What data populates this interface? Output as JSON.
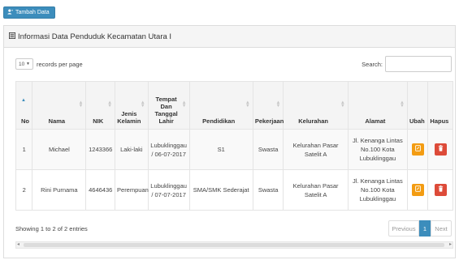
{
  "toolbar": {
    "add_label": "Tambah Data",
    "add_icon": "user-plus-icon"
  },
  "panel": {
    "title": "Informasi Data Penduduk Kecamatan Utara I",
    "title_icon": "list-icon"
  },
  "length": {
    "value": "10",
    "suffix": "records per page"
  },
  "search": {
    "label": "Search:",
    "value": ""
  },
  "table": {
    "columns": [
      {
        "key": "no",
        "label": "No"
      },
      {
        "key": "nama",
        "label": "Nama"
      },
      {
        "key": "nik",
        "label": "NIK"
      },
      {
        "key": "jk",
        "label": "Jenis Kelamin"
      },
      {
        "key": "ttl",
        "label": "Tempat Dan Tanggal Lahir"
      },
      {
        "key": "pendidikan",
        "label": "Pendidikan"
      },
      {
        "key": "pekerjaan",
        "label": "Pekerjaan"
      },
      {
        "key": "kelurahan",
        "label": "Kelurahan"
      },
      {
        "key": "alamat",
        "label": "Alamat"
      },
      {
        "key": "ubah",
        "label": "Ubah"
      },
      {
        "key": "hapus",
        "label": "Hapus"
      }
    ],
    "rows": [
      {
        "no": "1",
        "nama": "Michael",
        "nik": "1243366",
        "jk": "Laki-laki",
        "ttl": "Lubuklinggau / 06-07-2017",
        "pendidikan": "S1",
        "pekerjaan": "Swasta",
        "kelurahan": "Kelurahan Pasar Satelit A",
        "alamat": "Jl. Kenanga Lintas No.100 Kota Lubuklinggau"
      },
      {
        "no": "2",
        "nama": "Rini Purnama",
        "nik": "4646436",
        "jk": "Perempuan",
        "ttl": "Lubuklinggau / 07-07-2017",
        "pendidikan": "SMA/SMK Sederajat",
        "pekerjaan": "Swasta",
        "kelurahan": "Kelurahan Pasar Satelit A",
        "alamat": "Jl. Kenanga Lintas No.100 Kota Lubuklinggau"
      }
    ]
  },
  "footer": {
    "info": "Showing 1 to 2 of 2 entries",
    "prev": "Previous",
    "page": "1",
    "next": "Next"
  },
  "colors": {
    "primary": "#3c8dbc",
    "edit": "#f39c12",
    "delete": "#dd4b39"
  }
}
